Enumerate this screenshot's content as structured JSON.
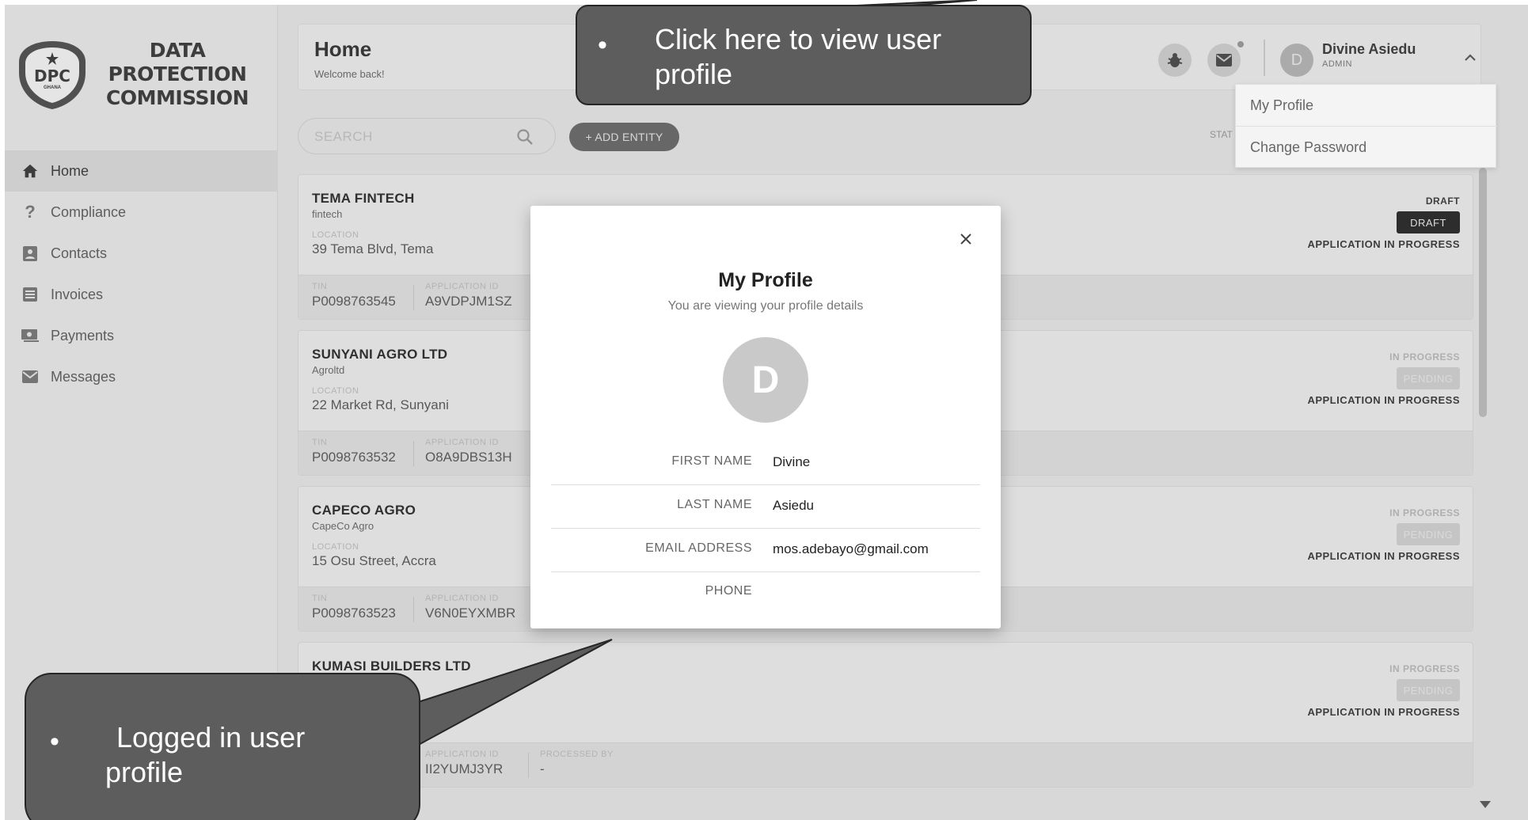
{
  "brand": {
    "name": "DATA PROTECTION COMMISSION",
    "badge_text": "DPC",
    "badge_subtext": "GHANA"
  },
  "sidebar": {
    "items": [
      {
        "label": "Home",
        "icon": "home-icon",
        "active": true
      },
      {
        "label": "Compliance",
        "icon": "question-icon",
        "active": false
      },
      {
        "label": "Contacts",
        "icon": "contacts-icon",
        "active": false
      },
      {
        "label": "Invoices",
        "icon": "invoice-icon",
        "active": false
      },
      {
        "label": "Payments",
        "icon": "payments-icon",
        "active": false
      },
      {
        "label": "Messages",
        "icon": "mail-icon",
        "active": false
      }
    ]
  },
  "header": {
    "title": "Home",
    "subtitle": "Welcome back!",
    "user": {
      "initial": "D",
      "name": "Divine Asiedu",
      "role": "ADMIN"
    }
  },
  "user_menu": {
    "items": [
      "My Profile",
      "Change Password"
    ]
  },
  "toolbar": {
    "search_placeholder": "SEARCH",
    "add_entity_label": "+ ADD ENTITY",
    "status_label": "STAT"
  },
  "labels": {
    "location": "LOCATION",
    "tin": "TIN",
    "application_id": "APPLICATION ID",
    "processed_by": "PROCESSED BY"
  },
  "entities": [
    {
      "name": "TEMA FINTECH",
      "sub": "fintech",
      "location": "39 Tema Blvd, Tema",
      "tin": "P0098763545",
      "application_id": "A9VDPJM1SZ",
      "status_small": "DRAFT",
      "badge": "DRAFT",
      "progress": "APPLICATION IN PROGRESS"
    },
    {
      "name": "SUNYANI AGRO LTD",
      "sub": "Agroltd",
      "location": "22 Market Rd, Sunyani",
      "tin": "P0098763532",
      "application_id": "O8A9DBS13H",
      "status_small": "IN PROGRESS",
      "badge": "PENDING",
      "progress": "APPLICATION IN PROGRESS"
    },
    {
      "name": "CAPECO AGRO",
      "sub": "CapeCo Agro",
      "location": "15 Osu Street, Accra",
      "tin": "P0098763523",
      "application_id": "V6N0EYXMBR",
      "status_small": "IN PROGRESS",
      "badge": "PENDING",
      "progress": "APPLICATION IN PROGRESS"
    },
    {
      "name": "KUMASI BUILDERS LTD",
      "application_id": "II2YUMJ3YR",
      "processed_by": "-",
      "status_small": "IN PROGRESS",
      "badge": "PENDING",
      "progress": "APPLICATION IN PROGRESS"
    }
  ],
  "modal": {
    "title": "My Profile",
    "subtitle": "You are viewing your profile details",
    "avatar_initial": "D",
    "fields": [
      {
        "label": "FIRST NAME",
        "value": "Divine"
      },
      {
        "label": "LAST NAME",
        "value": "Asiedu"
      },
      {
        "label": "EMAIL ADDRESS",
        "value": "mos.adebayo@gmail.com"
      },
      {
        "label": "PHONE",
        "value": ""
      }
    ]
  },
  "callouts": {
    "top": {
      "bullet": "•",
      "text": "Click here to view user profile"
    },
    "bottom": {
      "bullet": "•",
      "text": "Logged in user profile"
    }
  }
}
